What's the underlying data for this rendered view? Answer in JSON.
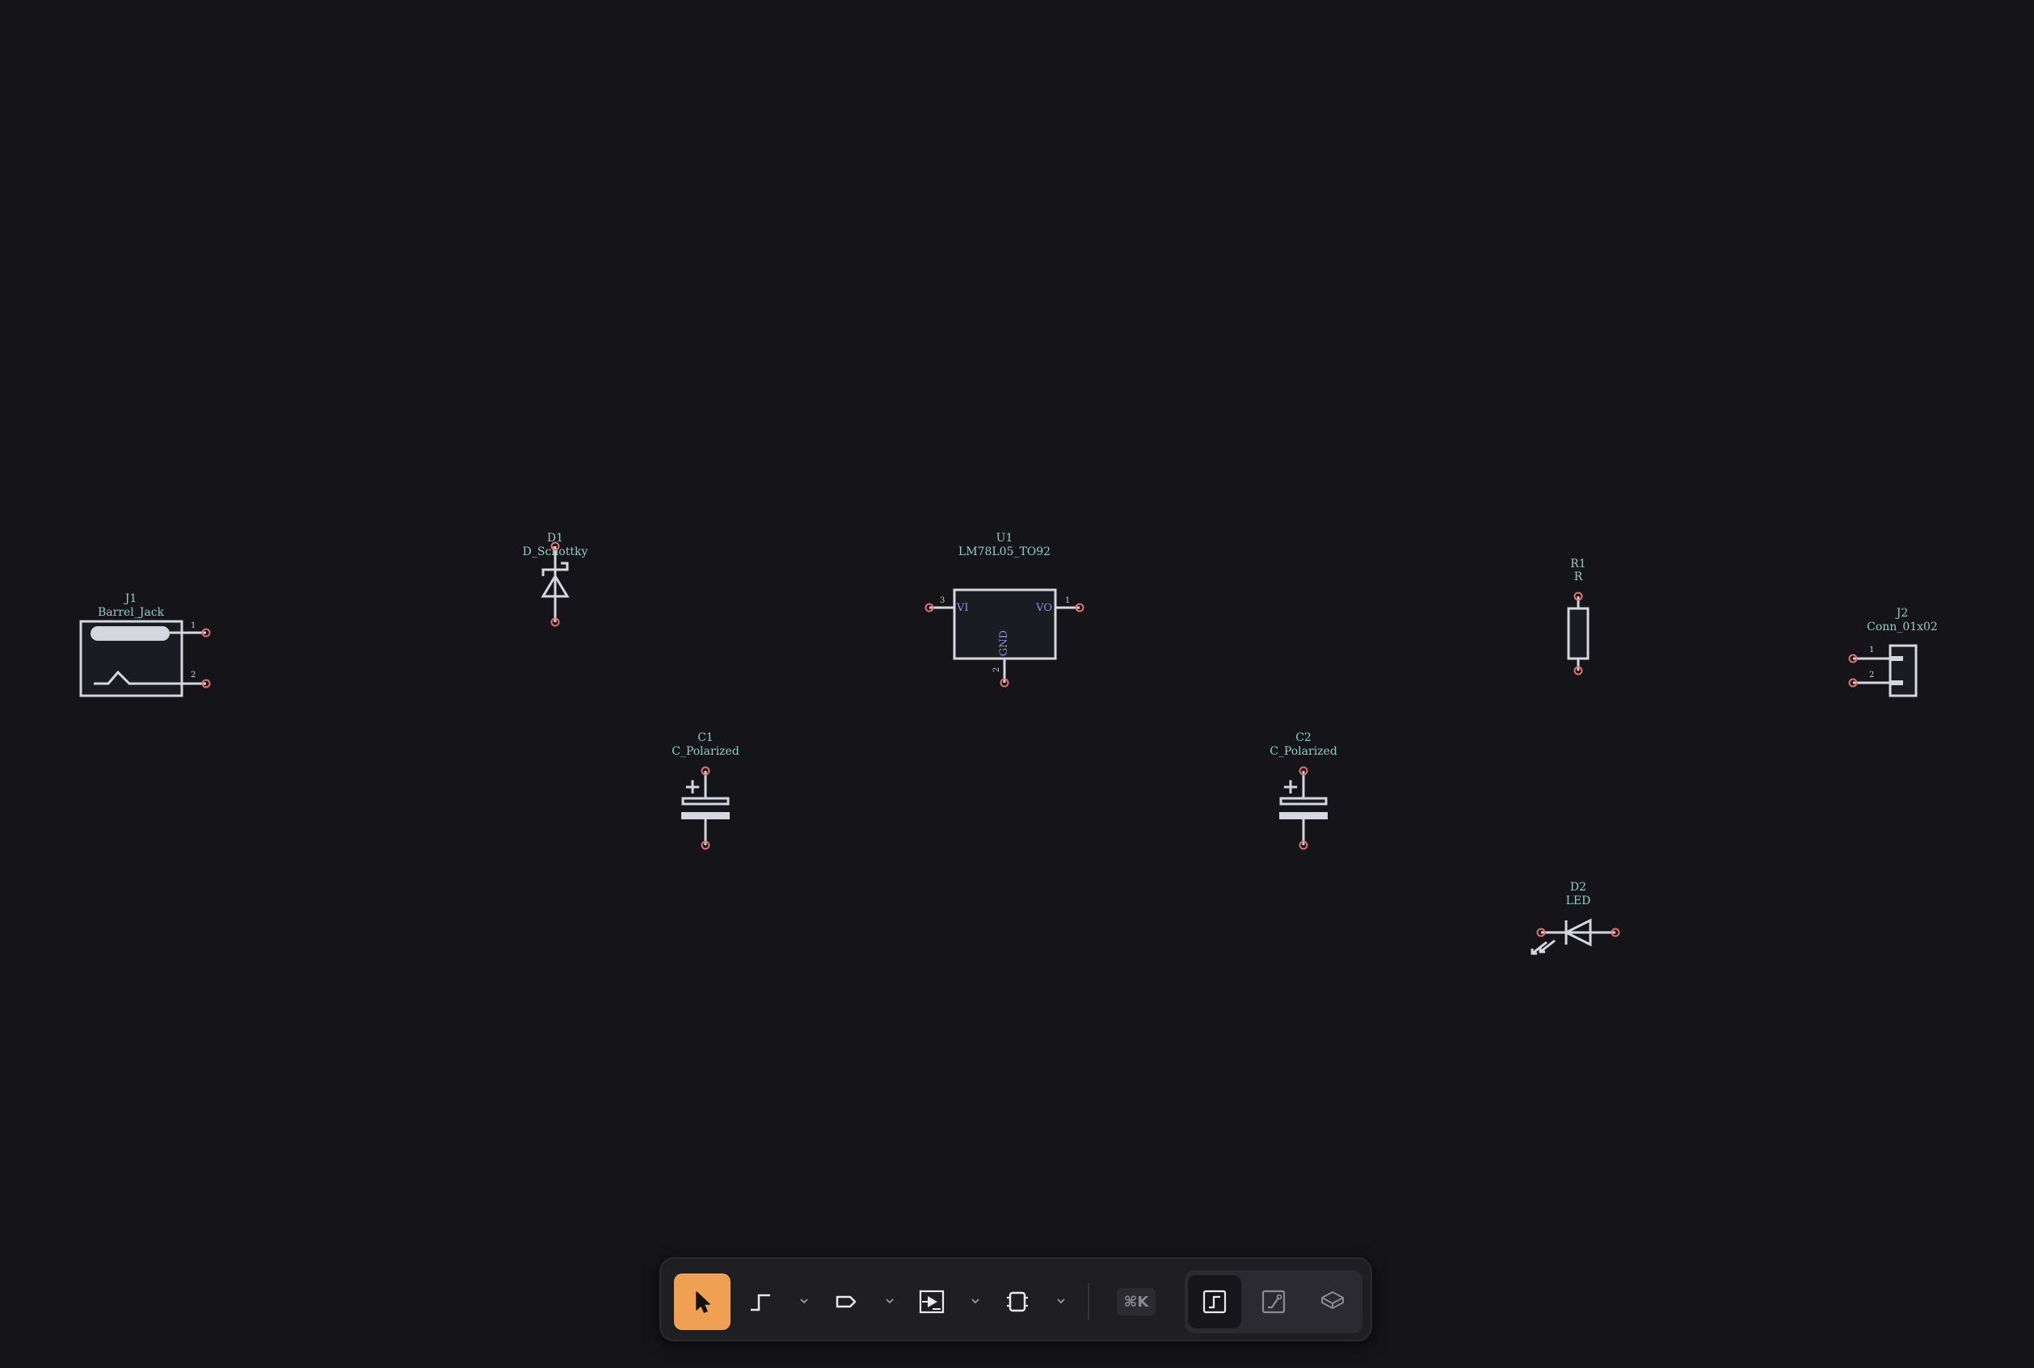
{
  "components": {
    "j1": {
      "ref": "J1",
      "value": "Barrel_Jack",
      "pin1": "1",
      "pin2": "2"
    },
    "d1": {
      "ref": "D1",
      "value": "D_Schottky"
    },
    "u1": {
      "ref": "U1",
      "value": "LM78L05_TO92",
      "pin_vi": "VI",
      "pin_vo": "VO",
      "pin_gnd": "GND",
      "pin3": "3",
      "pin1": "1",
      "pin2": "2"
    },
    "r1": {
      "ref": "R1",
      "value": "R"
    },
    "j2": {
      "ref": "J2",
      "value": "Conn_01x02",
      "pin1": "1",
      "pin2": "2"
    },
    "c1": {
      "ref": "C1",
      "value": "C_Polarized",
      "plus": "+"
    },
    "c2": {
      "ref": "C2",
      "value": "C_Polarized",
      "plus": "+"
    },
    "d2": {
      "ref": "D2",
      "value": "LED"
    }
  },
  "toolbar": {
    "tools": [
      {
        "name": "select",
        "icon": "cursor-arrow-icon",
        "active": true
      },
      {
        "name": "draw-wire",
        "icon": "wire-icon"
      },
      {
        "name": "net-label",
        "icon": "net-label-icon"
      },
      {
        "name": "place-symbol",
        "icon": "symbol-icon"
      },
      {
        "name": "place-chip",
        "icon": "chip-icon"
      }
    ],
    "shortcut_hint": "⌘K",
    "view_modes": [
      {
        "name": "schematic",
        "icon": "schematic-view-icon",
        "selected": true
      },
      {
        "name": "pcb",
        "icon": "pcb-view-icon"
      },
      {
        "name": "3d",
        "icon": "3d-view-icon"
      }
    ]
  },
  "colors": {
    "background": "#141419",
    "reference_text": "#8fd0c6",
    "pin_name_text": "#8e8ef0",
    "symbol_stroke": "#d6d6de",
    "pin_marker": "#e07272",
    "active_tool": "#f0a052"
  }
}
